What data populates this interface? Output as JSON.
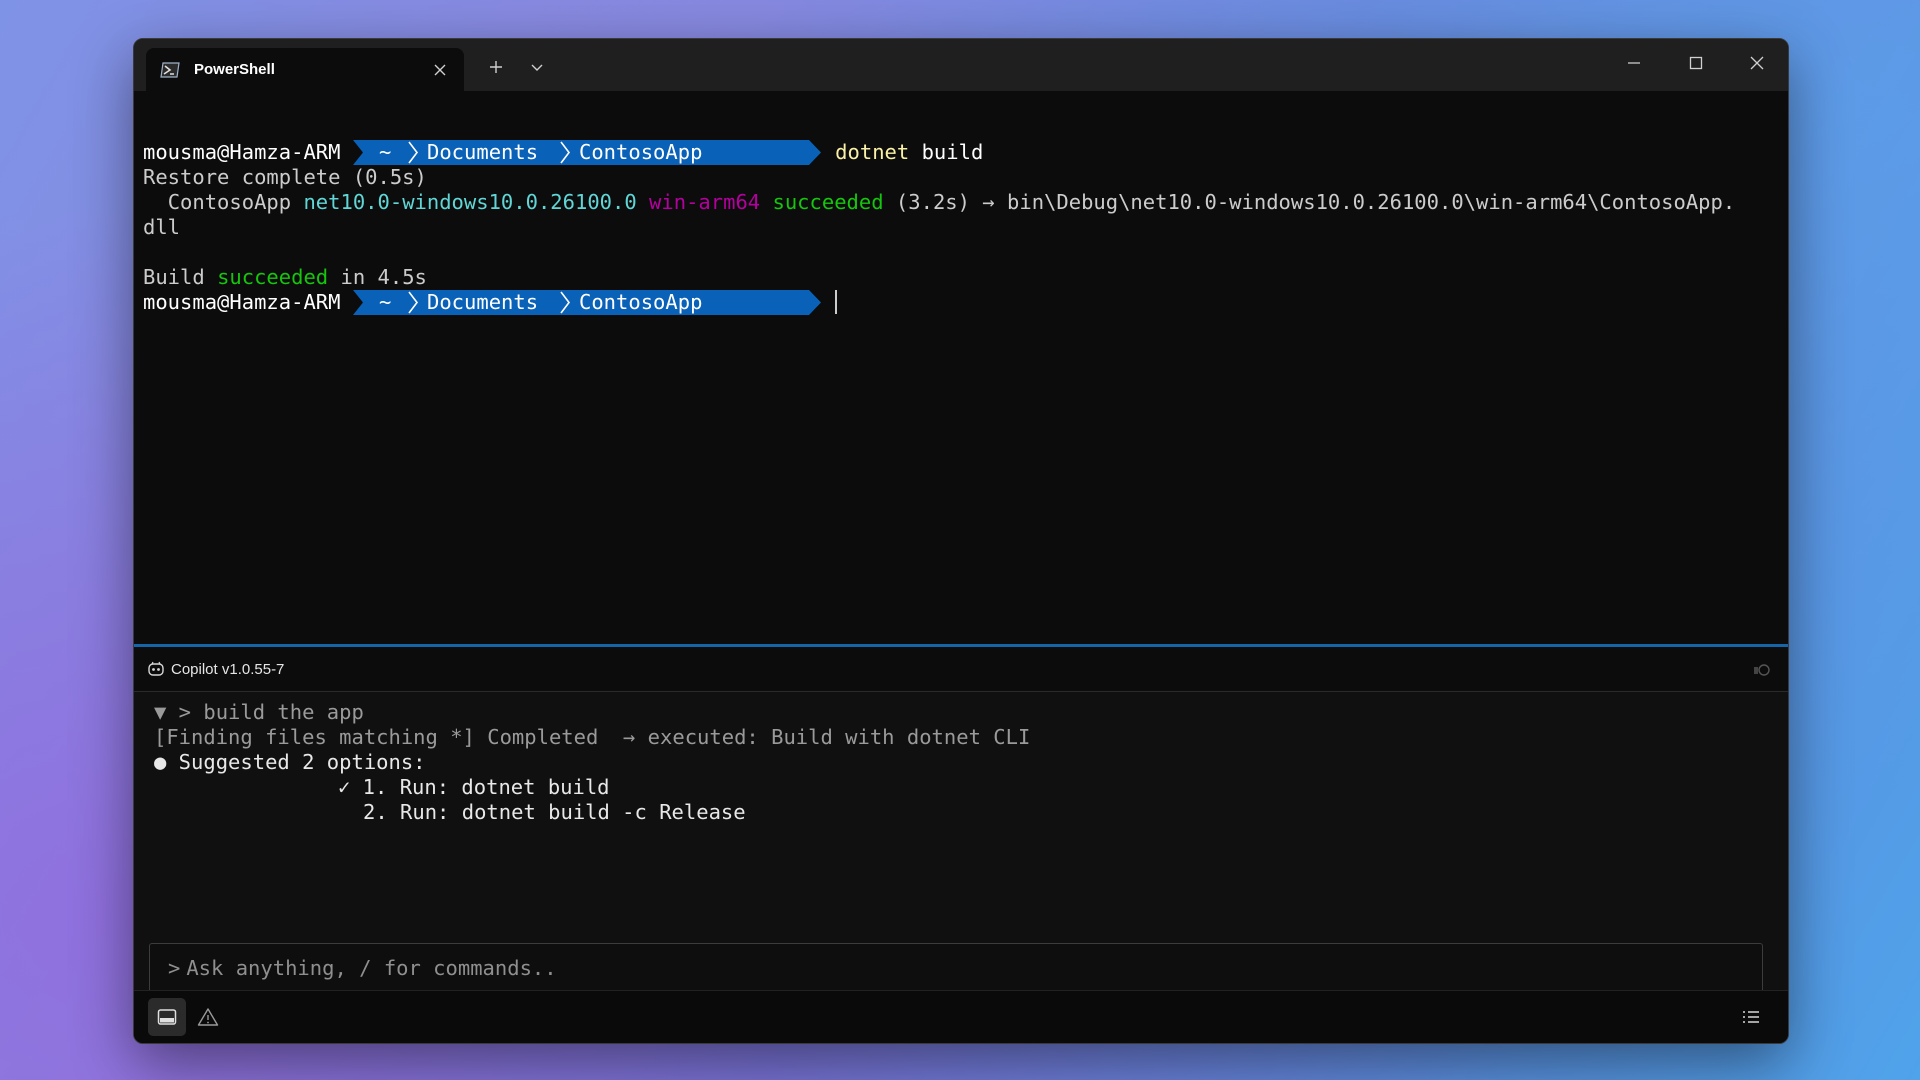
{
  "tab": {
    "title": "PowerShell"
  },
  "terminal": {
    "prompt": {
      "user": "mousma@Hamza-ARM",
      "segments": [
        "~",
        "Documents",
        "ContosoApp"
      ]
    },
    "command": {
      "name": "dotnet",
      "arg": "build"
    },
    "restore": "Restore complete (0.5s)",
    "project": {
      "name": "ContosoApp",
      "framework": "net10.0-windows10.0.26100.0",
      "runtime": "win-arm64",
      "status": "succeeded",
      "duration": "(3.2s) →",
      "output_path": "bin\\Debug\\net10.0-windows10.0.26100.0\\win-arm64\\ContosoApp.",
      "output_wrap": "dll"
    },
    "build": {
      "prefix": "Build",
      "status": "succeeded",
      "suffix": "in 4.5s"
    }
  },
  "copilot": {
    "title": "Copilot v1.0.55-7",
    "query": "▼ > build the app",
    "action": "[Finding files matching *] Completed  → executed: Build with dotnet CLI",
    "suggest": "● Suggested 2 options:",
    "options": [
      "✓ 1. Run: dotnet build",
      "2. Run: dotnet build -c Release"
    ],
    "input_prompt": ">",
    "input_placeholder": "Ask anything, / for commands.."
  },
  "colors": {
    "segment_bg": "#0a62b8",
    "accent_green": "#16c60c",
    "accent_cyan": "#61d6d6",
    "accent_magenta": "#b4009e",
    "divider": "#1565a8"
  },
  "icons": [
    "powershell-icon",
    "close-icon",
    "plus-icon",
    "chevron-down-icon",
    "minimize-icon",
    "maximize-icon",
    "copilot-icon",
    "terminal-panel-icon",
    "warning-icon",
    "list-icon"
  ]
}
